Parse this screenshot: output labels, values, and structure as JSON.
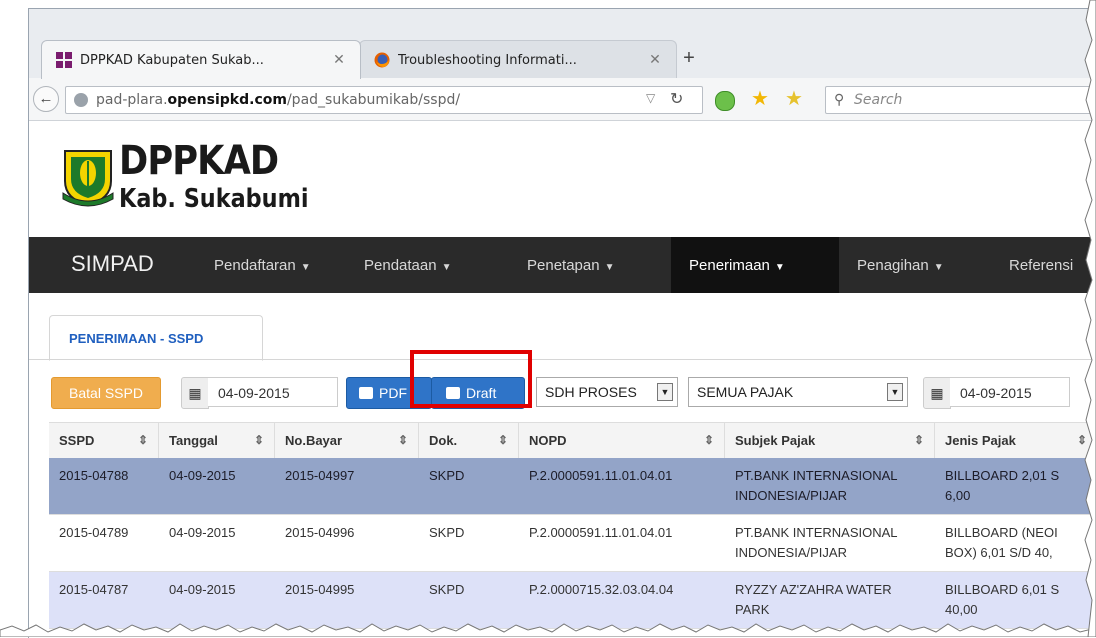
{
  "browser": {
    "tabs": [
      {
        "label": "DPPKAD Kabupaten Sukab...",
        "close": "✕",
        "active": true
      },
      {
        "label": "Troubleshooting Informati...",
        "close": "✕",
        "active": false
      }
    ],
    "new_tab": "+",
    "url": {
      "host_prefix": "pad-plara.",
      "host_domain": "opensipkd.com",
      "path": "/pad_sukabumikab/sspd/"
    },
    "search_placeholder": "Search"
  },
  "header": {
    "brand_line1": "DPPKAD",
    "brand_line2": "Kab. Sukabumi"
  },
  "menu": {
    "brand": "SIMPAD",
    "items": [
      {
        "label": "Pendaftaran"
      },
      {
        "label": "Pendataan"
      },
      {
        "label": "Penetapan"
      },
      {
        "label": "Penerimaan",
        "active": true
      },
      {
        "label": "Penagihan"
      },
      {
        "label": "Referensi"
      }
    ]
  },
  "page_tab": "PENERIMAAN - SSPD",
  "toolbar": {
    "batal_label": "Batal SSPD",
    "date_from": "04-09-2015",
    "pdf_label": "PDF",
    "draft_label": "Draft",
    "status_select": "SDH PROSES",
    "pajak_select": "SEMUA PAJAK",
    "date_to": "04-09-2015"
  },
  "table": {
    "columns": [
      "SSPD",
      "Tanggal",
      "No.Bayar",
      "Dok.",
      "NOPD",
      "Subjek Pajak",
      "Jenis Pajak"
    ],
    "rows": [
      {
        "sspd": "2015-04788",
        "tanggal": "04-09-2015",
        "no_bayar": "2015-04997",
        "dok": "SKPD",
        "nopd": "P.2.0000591.11.01.04.01",
        "subjek_1": "PT.BANK INTERNASIONAL",
        "subjek_2": "INDONESIA/PIJAR",
        "jenis_1": "BILLBOARD 2,01 S",
        "jenis_2": "6,00"
      },
      {
        "sspd": "2015-04789",
        "tanggal": "04-09-2015",
        "no_bayar": "2015-04996",
        "dok": "SKPD",
        "nopd": "P.2.0000591.11.01.04.01",
        "subjek_1": "PT.BANK INTERNASIONAL",
        "subjek_2": "INDONESIA/PIJAR",
        "jenis_1": "BILLBOARD (NEOI",
        "jenis_2": "BOX) 6,01 S/D 40,"
      },
      {
        "sspd": "2015-04787",
        "tanggal": "04-09-2015",
        "no_bayar": "2015-04995",
        "dok": "SKPD",
        "nopd": "P.2.0000715.32.03.04.04",
        "subjek_1": "RYZZY AZ'ZAHRA WATER",
        "subjek_2": "PARK",
        "jenis_1": "BILLBOARD 6,01 S",
        "jenis_2": "40,00"
      }
    ]
  },
  "colors": {
    "menu_bg": "#2a2a2a",
    "batal": "#f0ad4e",
    "primary": "#2f74c8",
    "highlight": "#e00000",
    "selected_row": "#93a4c8"
  }
}
